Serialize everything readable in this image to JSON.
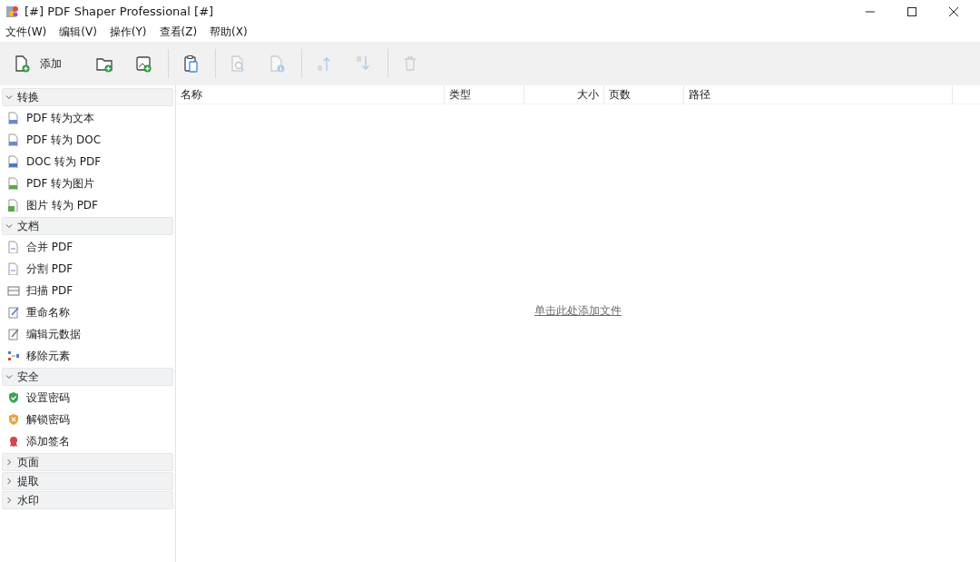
{
  "window": {
    "title": "[#] PDF Shaper Professional [#]"
  },
  "menu": [
    "文件(W)",
    "编辑(V)",
    "操作(Y)",
    "查看(Z)",
    "帮助(X)"
  ],
  "toolbar": [
    {
      "kind": "add-file",
      "label": "添加",
      "disabled": false
    },
    {
      "kind": "add-folder",
      "disabled": false
    },
    {
      "kind": "add-image",
      "disabled": false
    },
    {
      "kind": "separator"
    },
    {
      "kind": "paste",
      "disabled": false
    },
    {
      "kind": "separator"
    },
    {
      "kind": "preview",
      "disabled": true
    },
    {
      "kind": "info",
      "disabled": true
    },
    {
      "kind": "separator"
    },
    {
      "kind": "move-up",
      "disabled": true
    },
    {
      "kind": "move-down",
      "disabled": true
    },
    {
      "kind": "separator"
    },
    {
      "kind": "delete",
      "disabled": true
    }
  ],
  "sidebar": {
    "sections": [
      {
        "title": "转换",
        "expanded": true,
        "items": [
          {
            "label": "PDF 转为文本",
            "kind": "txt"
          },
          {
            "label": "PDF 转为 DOC",
            "kind": "doc"
          },
          {
            "label": "DOC 转为 PDF",
            "kind": "word"
          },
          {
            "label": "PDF 转为图片",
            "kind": "jpg"
          },
          {
            "label": "图片 转为 PDF",
            "kind": "img"
          }
        ]
      },
      {
        "title": "文档",
        "expanded": true,
        "items": [
          {
            "label": "合并 PDF",
            "kind": "merge"
          },
          {
            "label": "分割 PDF",
            "kind": "merge"
          },
          {
            "label": "扫描 PDF",
            "kind": "scan"
          },
          {
            "label": "重命名称",
            "kind": "rename"
          },
          {
            "label": "编辑元数据",
            "kind": "meta"
          },
          {
            "label": "移除元素",
            "kind": "remove"
          }
        ]
      },
      {
        "title": "安全",
        "expanded": true,
        "items": [
          {
            "label": "设置密码",
            "kind": "shield-ok"
          },
          {
            "label": "解锁密码",
            "kind": "shield-x"
          },
          {
            "label": "添加签名",
            "kind": "seal"
          }
        ]
      },
      {
        "title": "页面",
        "expanded": false
      },
      {
        "title": "提取",
        "expanded": false
      },
      {
        "title": "水印",
        "expanded": false
      }
    ]
  },
  "table": {
    "columns": [
      "名称",
      "类型",
      "大小",
      "页数",
      "路径"
    ],
    "empty_link": "单击此处添加文件"
  }
}
